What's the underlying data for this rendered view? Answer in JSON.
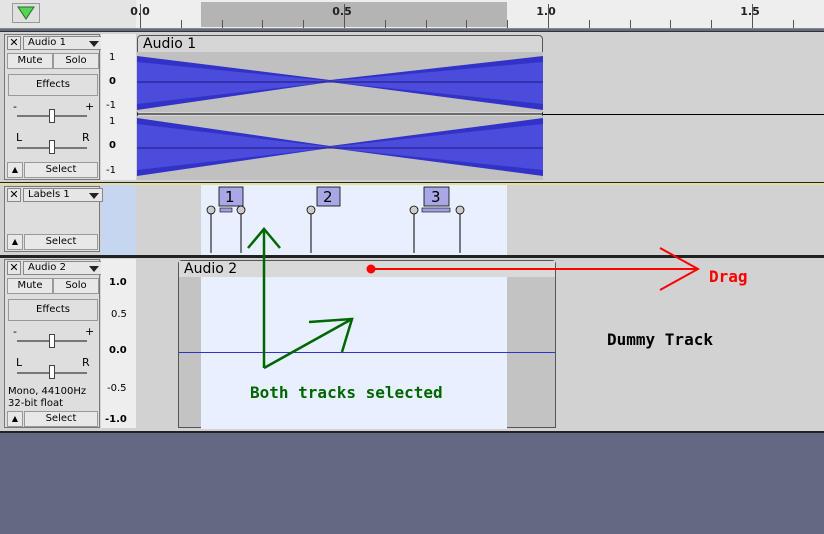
{
  "ruler": {
    "ticks": [
      "0.0",
      "0.5",
      "1.0",
      "1.5"
    ]
  },
  "track1": {
    "name": "Audio 1",
    "mute": "Mute",
    "solo": "Solo",
    "effects": "Effects",
    "gain_minus": "-",
    "gain_plus": "+",
    "pan_left": "L",
    "pan_right": "R",
    "select": "Select",
    "clip_name": "Audio 1",
    "scale": [
      "1",
      "0",
      "-1",
      "1",
      "0",
      "-1"
    ]
  },
  "label_track": {
    "name": "Labels 1",
    "select": "Select",
    "labels": [
      "1",
      "2",
      "3"
    ]
  },
  "track2": {
    "name": "Audio 2",
    "mute": "Mute",
    "solo": "Solo",
    "effects": "Effects",
    "gain_minus": "-",
    "gain_plus": "+",
    "pan_left": "L",
    "pan_right": "R",
    "info_line1": "Mono, 44100Hz",
    "info_line2": "32-bit float",
    "select": "Select",
    "clip_name": "Audio 2",
    "scale": [
      "1.0",
      "0.5",
      "0.0",
      "-0.5",
      "-1.0"
    ]
  },
  "annotations": {
    "drag": "Drag",
    "dummy": "Dummy Track",
    "both_selected": "Both tracks selected"
  },
  "colors": {
    "background": "#636883",
    "waveform": "#3232c8",
    "selection": "#e8f0ff",
    "drag_arrow": "#ff0000",
    "selected_arrow": "#006600"
  }
}
